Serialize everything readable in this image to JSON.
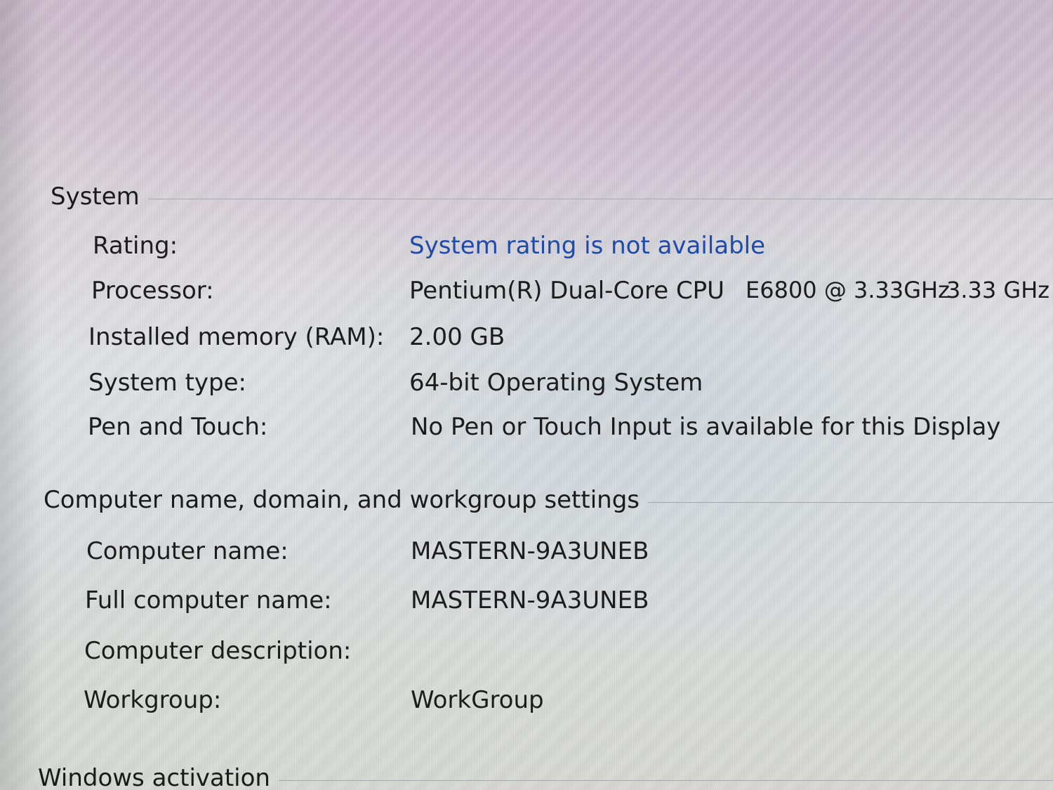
{
  "system": {
    "heading": "System",
    "rating_label": "Rating:",
    "rating_link": "System rating is not available",
    "processor_label": "Processor:",
    "processor_name": "Pentium(R) Dual-Core  CPU",
    "processor_model": "E6800  @ 3.33GHz",
    "processor_speed": "3.33 GHz",
    "ram_label": "Installed memory (RAM):",
    "ram_value": "2.00 GB",
    "system_type_label": "System type:",
    "system_type_value": "64-bit Operating System",
    "pen_touch_label": "Pen and Touch:",
    "pen_touch_value": "No Pen or Touch Input is available for this Display"
  },
  "computer_name": {
    "heading": "Computer name, domain, and workgroup settings",
    "computer_name_label": "Computer name:",
    "computer_name_value": "MASTERN-9A3UNEB",
    "full_name_label": "Full computer name:",
    "full_name_value": "MASTERN-9A3UNEB",
    "description_label": "Computer description:",
    "description_value": "",
    "workgroup_label": "Workgroup:",
    "workgroup_value": "WorkGroup"
  },
  "activation": {
    "heading": "Windows activation"
  },
  "colors": {
    "link": "#1f4aa8",
    "text": "#1c1c1c",
    "rule": "#8f9398"
  }
}
